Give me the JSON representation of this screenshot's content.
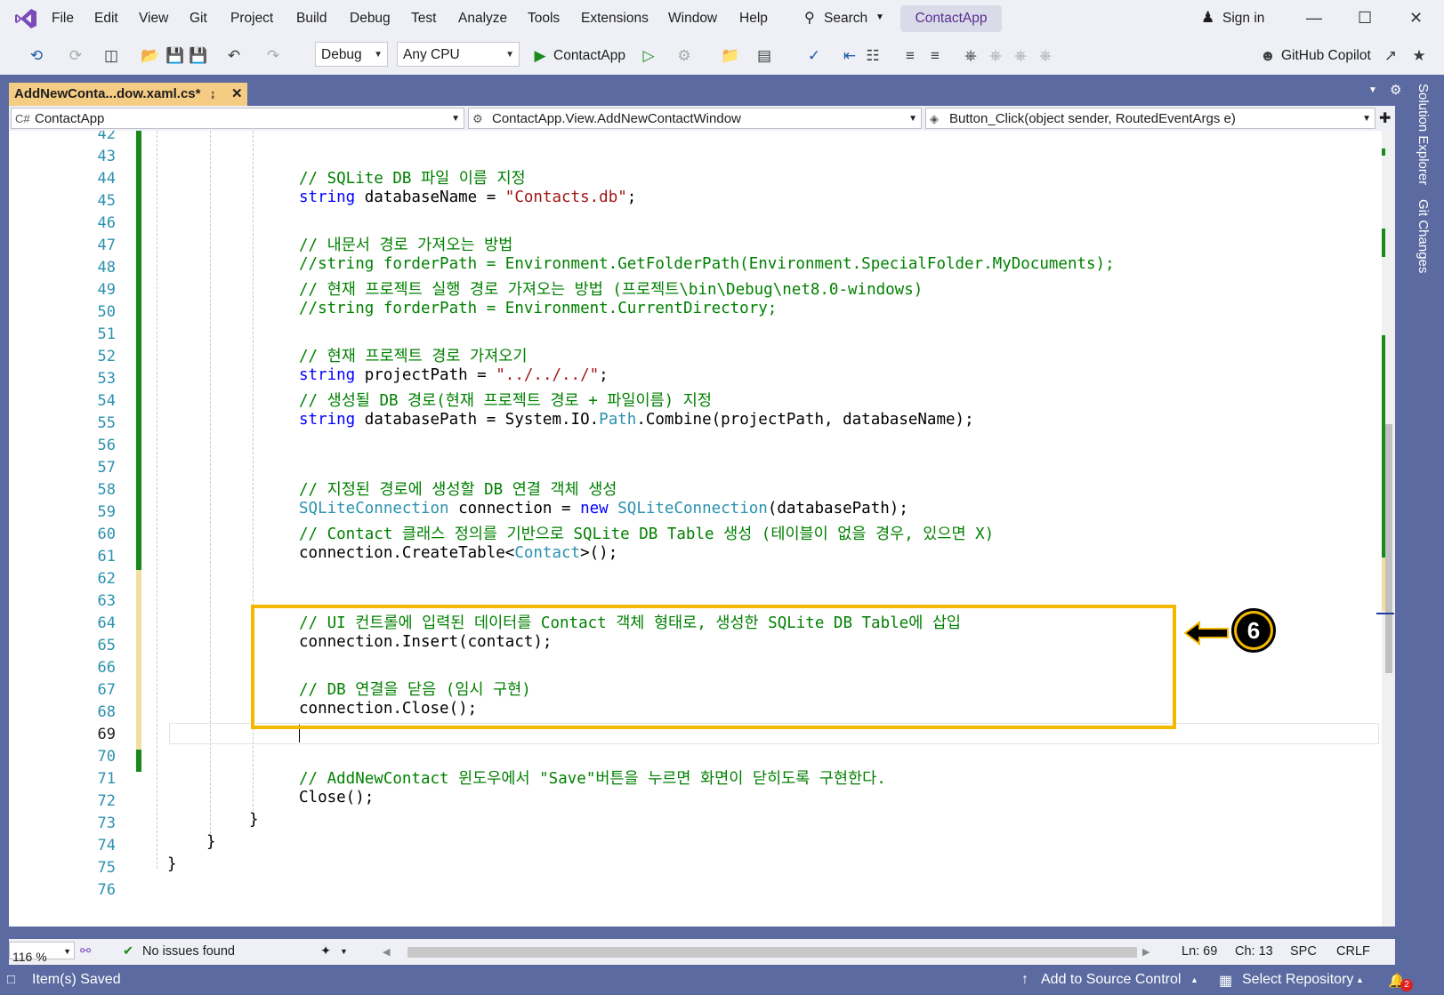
{
  "menu": [
    "File",
    "Edit",
    "View",
    "Git",
    "Project",
    "Build",
    "Debug",
    "Test",
    "Analyze",
    "Tools",
    "Extensions",
    "Window",
    "Help"
  ],
  "search_label": "Search",
  "app_name": "ContactApp",
  "sign_in": "Sign in",
  "toolbar": {
    "config": "Debug",
    "platform": "Any CPU",
    "run_target": "ContactApp",
    "copilot": "GitHub Copilot"
  },
  "doc_tab": "AddNewConta...dow.xaml.cs*",
  "nav": {
    "project": "ContactApp",
    "class": "ContactApp.View.AddNewContactWindow",
    "member": "Button_Click(object sender, RoutedEventArgs e)"
  },
  "line_numbers": [
    "42",
    "43",
    "44",
    "45",
    "46",
    "47",
    "48",
    "49",
    "50",
    "51",
    "52",
    "53",
    "54",
    "55",
    "56",
    "57",
    "58",
    "59",
    "60",
    "61",
    "62",
    "63",
    "64",
    "65",
    "66",
    "67",
    "68",
    "69",
    "70",
    "71",
    "72",
    "73",
    "74",
    "75",
    "76"
  ],
  "code": {
    "l44": "// SQLite DB 파일 이름 지정",
    "l45_kw": "string",
    "l45_a": " databaseName = ",
    "l45_str": "\"Contacts.db\"",
    "l45_b": ";",
    "l47": "// 내문서 경로 가져오는 방법",
    "l48": "//string forderPath = Environment.GetFolderPath(Environment.SpecialFolder.MyDocuments);",
    "l49": "// 현재 프로젝트 실행 경로 가져오는 방법 (프로젝트\\bin\\Debug\\net8.0-windows)",
    "l50": "//string forderPath = Environment.CurrentDirectory;",
    "l52": "// 현재 프로젝트 경로 가져오기",
    "l53_kw": "string",
    "l53_a": " projectPath = ",
    "l53_str": "\"../../../\"",
    "l53_b": ";",
    "l54": "// 생성될 DB 경로(현재 프로젝트 경로 + 파일이름) 지정",
    "l55_kw": "string",
    "l55_a": " databasePath = System.IO.",
    "l55_ty": "Path",
    "l55_b": ".Combine(projectPath, databaseName);",
    "l58": "// 지정된 경로에 생성할 DB 연결 객체 생성",
    "l59_ty": "SQLiteConnection",
    "l59_a": " connection = ",
    "l59_kw": "new",
    "l59_sp": " ",
    "l59_ty2": "SQLiteConnection",
    "l59_b": "(databasePath);",
    "l60": "// Contact 클래스 정의를 기반으로 SQLite DB Table 생성 (테이블이 없을 경우, 있으면 X)",
    "l61_a": "connection.CreateTable<",
    "l61_ty": "Contact",
    "l61_b": ">();",
    "l64": "// UI 컨트롤에 입력된 데이터를 Contact 객체 형태로, 생성한 SQLite DB Table에 삽입",
    "l65": "connection.Insert(contact);",
    "l67": "// DB 연결을 닫음 (임시 구현)",
    "l68": "connection.Close();",
    "l71": "// AddNewContact 윈도우에서 \"Save\"버튼을 누르면 화면이 닫히도록 구현한다.",
    "l72": "Close();",
    "l73": "}",
    "l74": "}",
    "l75": "}"
  },
  "callout_number": "6",
  "editor_status": {
    "zoom": "116 %",
    "issues": "No issues found",
    "ln": "Ln: 69",
    "ch": "Ch: 13",
    "spc": "SPC",
    "crlf": "CRLF"
  },
  "right_tabs": [
    "Solution Explorer",
    "Git Changes"
  ],
  "statusbar": {
    "saved": "Item(s) Saved",
    "add_source": "Add to Source Control",
    "select_repo": "Select Repository",
    "notif_count": "2"
  },
  "colors": {
    "accent": "#5b6aa0",
    "highlight": "#f5b800",
    "comment": "#008000",
    "keyword": "#0000ff",
    "string": "#a31515",
    "type": "#2b91af"
  }
}
